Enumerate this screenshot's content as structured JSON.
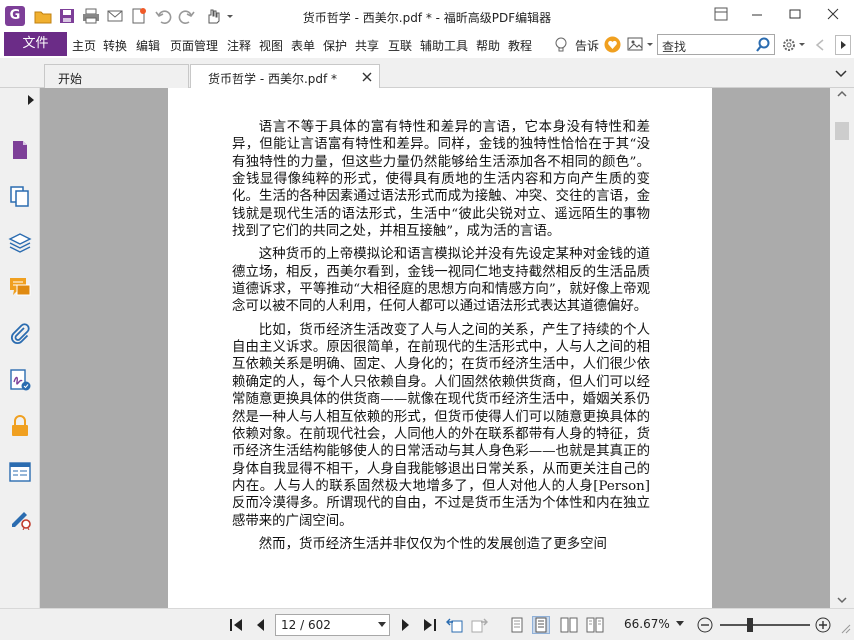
{
  "window": {
    "title": "货币哲学 - 西美尔.pdf * - 福昕高级PDF编辑器",
    "logo_letter": "G"
  },
  "menubar": {
    "file": "文件",
    "items": [
      "主页",
      "转换",
      "编辑",
      "页面管理",
      "注释",
      "视图",
      "表单",
      "保护",
      "共享",
      "互联",
      "辅助工具",
      "帮助",
      "教程"
    ],
    "tell_me": "告诉",
    "search_placeholder": "查找"
  },
  "tabs": [
    {
      "label": "开始"
    },
    {
      "label": "货币哲学 - 西美尔.pdf *"
    }
  ],
  "document": {
    "paragraphs": [
      "语言不等于具体的富有特性和差异的言语，它本身没有特性和差异，但能让言语富有特性和差异。同样，金钱的独特性恰恰在于其“没有独特性的力量，但这些力量仍然能够给生活添加各不相同的颜色”。金钱显得像纯粹的形式，使得具有质地的生活内容和方向产生质的变化。生活的各种因素通过语法形式而成为接触、冲突、交往的言语，金钱就是现代生活的语法形式，生活中“彼此尖锐对立、遥远陌生的事物找到了它们的共同之处，并相互接触”，成为活的言语。",
      "这种货币的上帝模拟论和语言模拟论并没有先设定某种对金钱的道德立场，相反，西美尔看到，金钱一视同仁地支持截然相反的生活品质道德诉求，平等推动“大相径庭的思想方向和情感方向”，就好像上帝观念可以被不同的人利用，任何人都可以通过语法形式表达其道德偏好。",
      "比如，货币经济生活改变了人与人之间的关系，产生了持续的个人自由主义诉求。原因很简单，在前现代的生活形式中，人与人之间的相互依赖关系是明确、固定、人身化的；在货币经济生活中，人们很少依赖确定的人，每个人只依赖自身。人们固然依赖供货商，但人们可以经常随意更换具体的供货商——就像在现代货币经济生活中，婚姻关系仍然是一种人与人相互依赖的形式，但货币使得人们可以随意更换具体的依赖对象。在前现代社会，人同他人的外在联系都带有人身的特征，货币经济生活结构能够使人的日常活动与其人身色彩——也就是其真正的身体自我显得不相干，人身自我能够退出日常关系，从而更关注自己的内在。人与人的联系固然极大地增多了，但人对他人的人身[Person]反而冷漠得多。所谓现代的自由，不过是货币生活为个体性和内在独立感带来的广阔空间。",
      "然而，货币经济生活并非仅仅为个性的发展创造了更多空间"
    ]
  },
  "statusbar": {
    "page_indicator": "12 / 602",
    "zoom": "66.67%"
  },
  "colors": {
    "brand": "#6b2c87",
    "panel_bg": "#f0f0f0",
    "doc_bg": "#ababab",
    "icon_blue": "#2b6cb0",
    "icon_orange": "#f0a020"
  }
}
